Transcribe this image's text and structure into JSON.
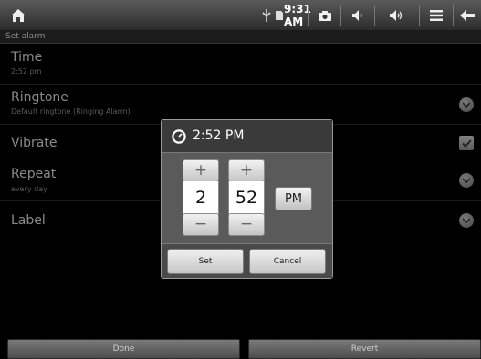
{
  "statusbar": {
    "time": "9:31 AM",
    "icons": [
      "home-icon",
      "usb-icon",
      "sd-card-icon",
      "camera-icon",
      "volume-down-icon",
      "volume-up-icon",
      "menu-icon",
      "back-icon"
    ]
  },
  "titlebar": {
    "title": "Set alarm"
  },
  "settings": {
    "time": {
      "title": "Time",
      "value": "2:52 pm"
    },
    "ringtone": {
      "title": "Ringtone",
      "value": "Default ringtone (Ringing Alarm)"
    },
    "vibrate": {
      "title": "Vibrate",
      "checked": true
    },
    "repeat": {
      "title": "Repeat",
      "value": "every day"
    },
    "label": {
      "title": "Label"
    }
  },
  "dialog": {
    "title": "2:52 PM",
    "hour": "2",
    "minute": "52",
    "ampm": "PM",
    "increment_symbol": "+",
    "decrement_symbol": "−",
    "set_label": "Set",
    "cancel_label": "Cancel"
  },
  "bottom": {
    "done_label": "Done",
    "revert_label": "Revert"
  }
}
